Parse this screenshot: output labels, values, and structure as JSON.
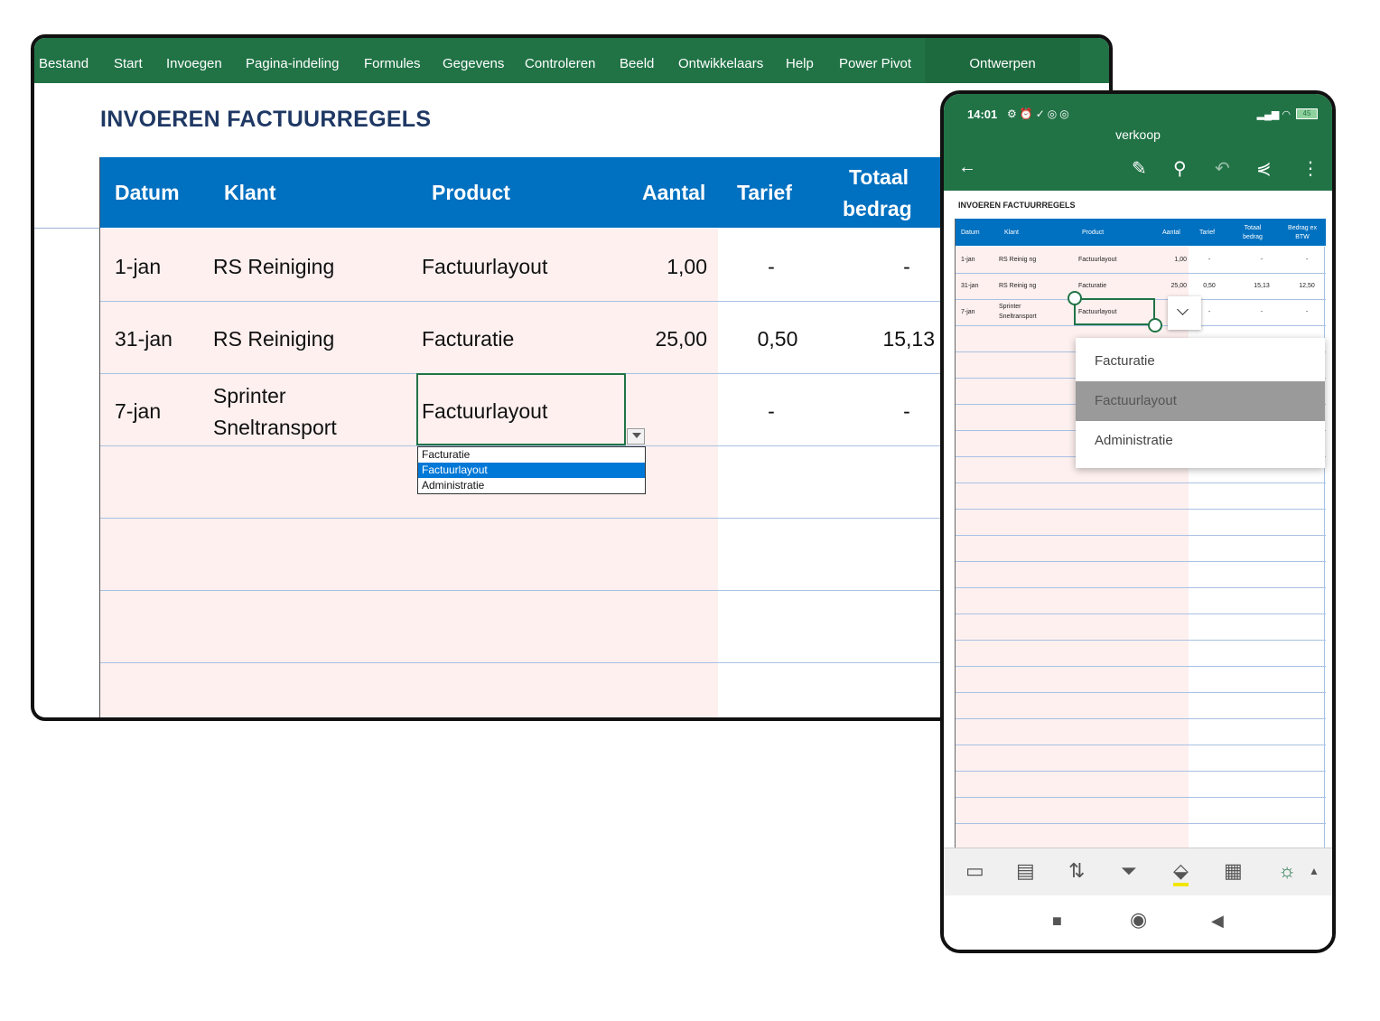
{
  "desktop": {
    "ribbon_tabs": [
      "Bestand",
      "Start",
      "Invoegen",
      "Pagina-indeling",
      "Formules",
      "Gegevens",
      "Controleren",
      "Beeld",
      "Ontwikkelaars",
      "Help",
      "Power Pivot"
    ],
    "context_tab": "Ontwerpen",
    "sheet_title": "INVOEREN FACTUURREGELS",
    "headers": {
      "datum": "Datum",
      "klant": "Klant",
      "product": "Product",
      "aantal": "Aantal",
      "tarief": "Tarief",
      "totaal_line1": "Totaal",
      "totaal_line2": "bedrag"
    },
    "rows": [
      {
        "datum": "1-jan",
        "klant": "RS Reiniging",
        "klant2": "",
        "product": "Factuurlayout",
        "aantal": "1,00",
        "tarief": "-",
        "totaal": "-"
      },
      {
        "datum": "31-jan",
        "klant": "RS Reiniging",
        "klant2": "",
        "product": "Facturatie",
        "aantal": "25,00",
        "tarief": "0,50",
        "totaal": "15,13"
      },
      {
        "datum": "7-jan",
        "klant": "Sprinter",
        "klant2": "Sneltransport",
        "product": "Factuurlayout",
        "aantal": "",
        "tarief": "-",
        "totaal": "-"
      }
    ],
    "dropdown_options": [
      "Facturatie",
      "Factuurlayout",
      "Administratie"
    ],
    "dropdown_selected": "Factuurlayout"
  },
  "phone": {
    "time": "14:01",
    "battery": "45",
    "file_name": "verkoop",
    "sheet_title": "INVOEREN FACTUURREGELS",
    "headers": {
      "datum": "Datum",
      "klant": "Klant",
      "product": "Product",
      "aantal": "Aantal",
      "tarief": "Tarief",
      "totaal_line1": "Totaal",
      "totaal_line2": "bedrag",
      "bedrag_line1": "Bedrag ex",
      "bedrag_line2": "BTW"
    },
    "rows": [
      {
        "datum": "1-jan",
        "klant": "RS Reinig ng",
        "klant2": "",
        "product": "Factuurlayout",
        "aantal": "1,00",
        "tarief": "-",
        "totaal": "-",
        "bedrag": "-"
      },
      {
        "datum": "31-jan",
        "klant": "RS Reinig ng",
        "klant2": "",
        "product": "Facturatie",
        "aantal": "25,00",
        "tarief": "0,50",
        "totaal": "15,13",
        "bedrag": "12,50"
      },
      {
        "datum": "7-jan",
        "klant": "Sprinter",
        "klant2": "Sneltransport",
        "product": "Factuurlayout",
        "aantal": "",
        "tarief": "-",
        "totaal": "-",
        "bedrag": "-"
      }
    ],
    "menu_options": [
      "Facturatie",
      "Factuurlayout",
      "Administratie"
    ],
    "menu_selected": "Factuurlayout",
    "accent": "#217346",
    "header_blue": "#0070c0"
  }
}
